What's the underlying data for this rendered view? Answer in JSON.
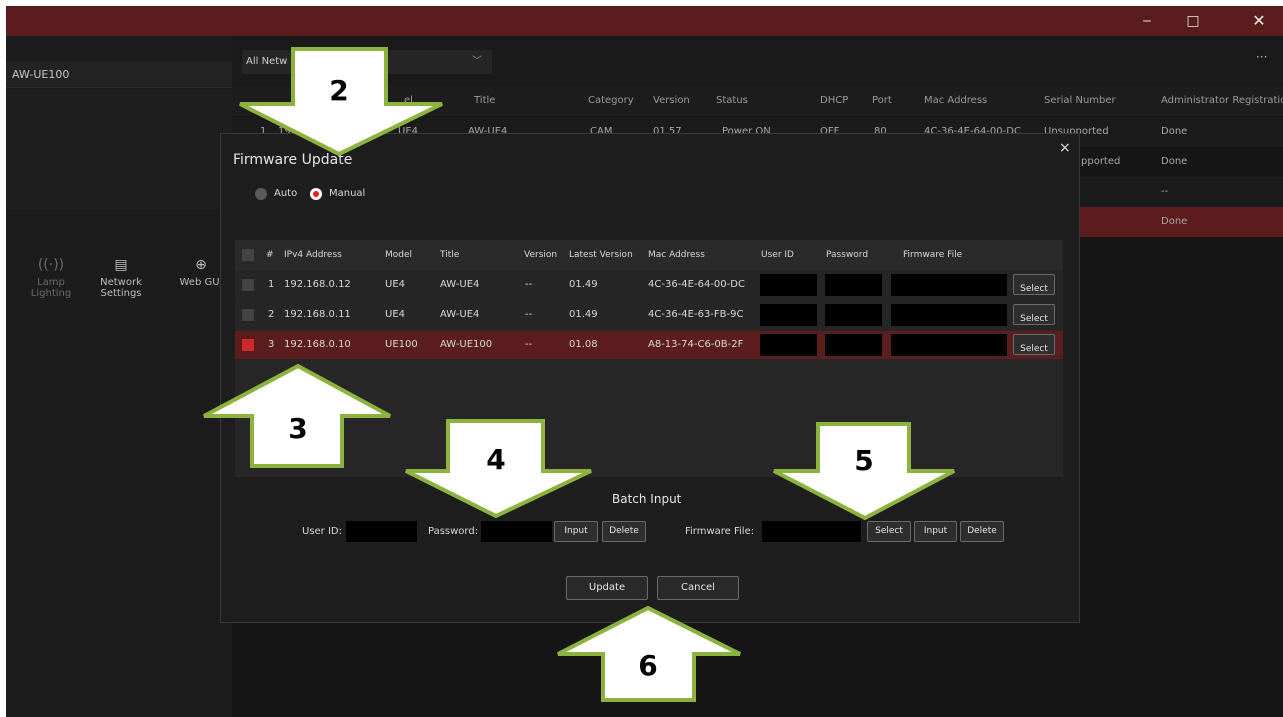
{
  "window": {
    "minimize": "‒",
    "maximize": "□",
    "close": "✕"
  },
  "sidebar": {
    "device": "AW-UE100",
    "tools": [
      {
        "label": "Lamp Lighting",
        "icon": "((·))"
      },
      {
        "label": "Network Settings",
        "icon": "▤"
      },
      {
        "label": "Web GUI",
        "icon": "⊕"
      }
    ]
  },
  "top": {
    "filter_label": "All Netw",
    "filter_chevron": "﹀",
    "more": "···"
  },
  "bg_table": {
    "headers": [
      "Title",
      "Category",
      "Version",
      "Status",
      "DHCP",
      "Port",
      "Mac Address",
      "Serial Number",
      "Administrator Registration"
    ],
    "partial_header": "el",
    "rows": [
      {
        "num": "1",
        "ip": "192.1",
        "model": "UE4",
        "title": "AW-UE4",
        "category": "CAM",
        "version": "01.57",
        "status": "Power ON",
        "dhcp": "OFF",
        "port": "80",
        "mac": "4C-36-4E-64-00-DC",
        "serial": "Unsupported",
        "admin": "Done"
      },
      {
        "serial": "pported",
        "admin": "Done"
      },
      {
        "admin": "--"
      },
      {
        "admin": "Done"
      }
    ]
  },
  "dialog": {
    "title": "Firmware Update",
    "close": "×",
    "mode_auto": "Auto",
    "mode_manual": "Manual",
    "columns": [
      "#",
      "IPv4 Address",
      "Model",
      "Title",
      "Version",
      "Latest Version",
      "Mac Address",
      "User ID",
      "Password",
      "Firmware File"
    ],
    "rows": [
      {
        "num": "1",
        "ip": "192.168.0.12",
        "model": "UE4",
        "title": "AW-UE4",
        "version": "--",
        "latest": "01.49",
        "mac": "4C-36-4E-64-00-DC",
        "select": "Select"
      },
      {
        "num": "2",
        "ip": "192.168.0.11",
        "model": "UE4",
        "title": "AW-UE4",
        "version": "--",
        "latest": "01.49",
        "mac": "4C-36-4E-63-FB-9C",
        "select": "Select"
      },
      {
        "num": "3",
        "ip": "192.168.0.10",
        "model": "UE100",
        "title": "AW-UE100",
        "version": "--",
        "latest": "01.08",
        "mac": "A8-13-74-C6-0B-2F",
        "select": "Select"
      }
    ],
    "batch": {
      "title": "Batch Input",
      "user_id_label": "User ID:",
      "password_label": "Password:",
      "firmware_label": "Firmware File:",
      "input": "Input",
      "delete": "Delete",
      "select": "Select"
    },
    "update": "Update",
    "cancel": "Cancel"
  },
  "annotations": [
    "2",
    "3",
    "4",
    "5",
    "6"
  ],
  "colors": {
    "titlebar": "#5a1c1c",
    "selected_row": "#5b1d1d",
    "arrow_fill": "#ffffff",
    "arrow_outline": "#8db33f",
    "radio_on": "#e02020"
  }
}
